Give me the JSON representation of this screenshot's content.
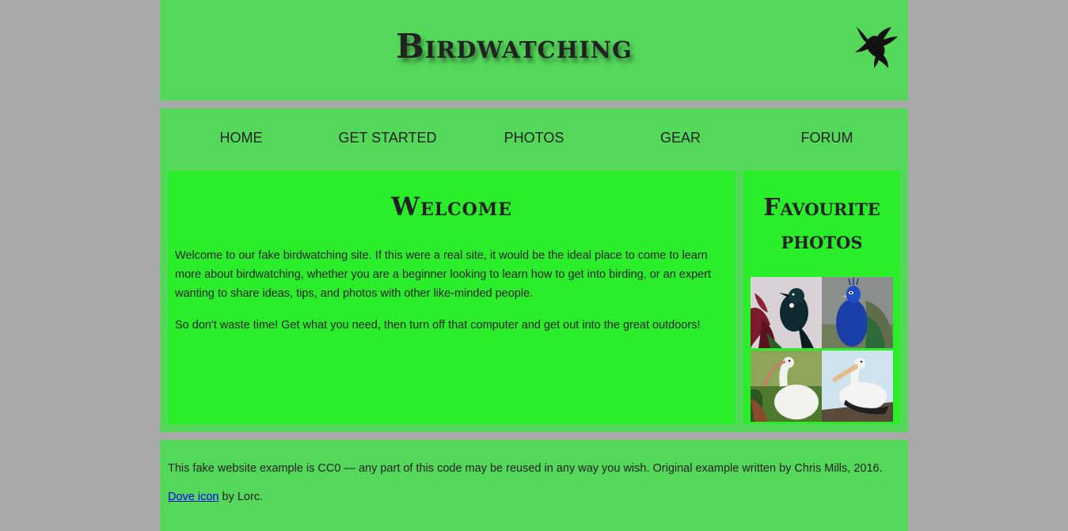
{
  "header": {
    "title": "Birdwatching",
    "logo_icon": "dove-icon"
  },
  "nav": {
    "items": [
      {
        "label": "Home"
      },
      {
        "label": "Get started"
      },
      {
        "label": "Photos"
      },
      {
        "label": "Gear"
      },
      {
        "label": "Forum"
      }
    ]
  },
  "main": {
    "heading": "Welcome",
    "paragraphs": [
      "Welcome to our fake birdwatching site. If this were a real site, it would be the ideal place to come to learn more about birdwatching, whether you are a beginner looking to learn how to get into birding, or an expert wanting to share ideas, tips, and photos with other like-minded people.",
      "So don't waste time! Get what you need, then turn off that computer and get out into the great outdoors!"
    ]
  },
  "aside": {
    "heading": "Favourite photos",
    "photos": [
      {
        "name": "tui-photo"
      },
      {
        "name": "peacock-photo"
      },
      {
        "name": "ibis-photo"
      },
      {
        "name": "pelican-photo"
      }
    ]
  },
  "footer": {
    "license_text": "This fake website example is CC0 — any part of this code may be reused in any way you wish. Original example written by Chris Mills, 2016.",
    "credit_link": "Dove icon",
    "credit_suffix": " by Lorc."
  },
  "colors": {
    "page_background": "#a9a9a9",
    "panel_green": "#54d85a",
    "content_green": "#2aee2a",
    "link": "#0000ee"
  }
}
